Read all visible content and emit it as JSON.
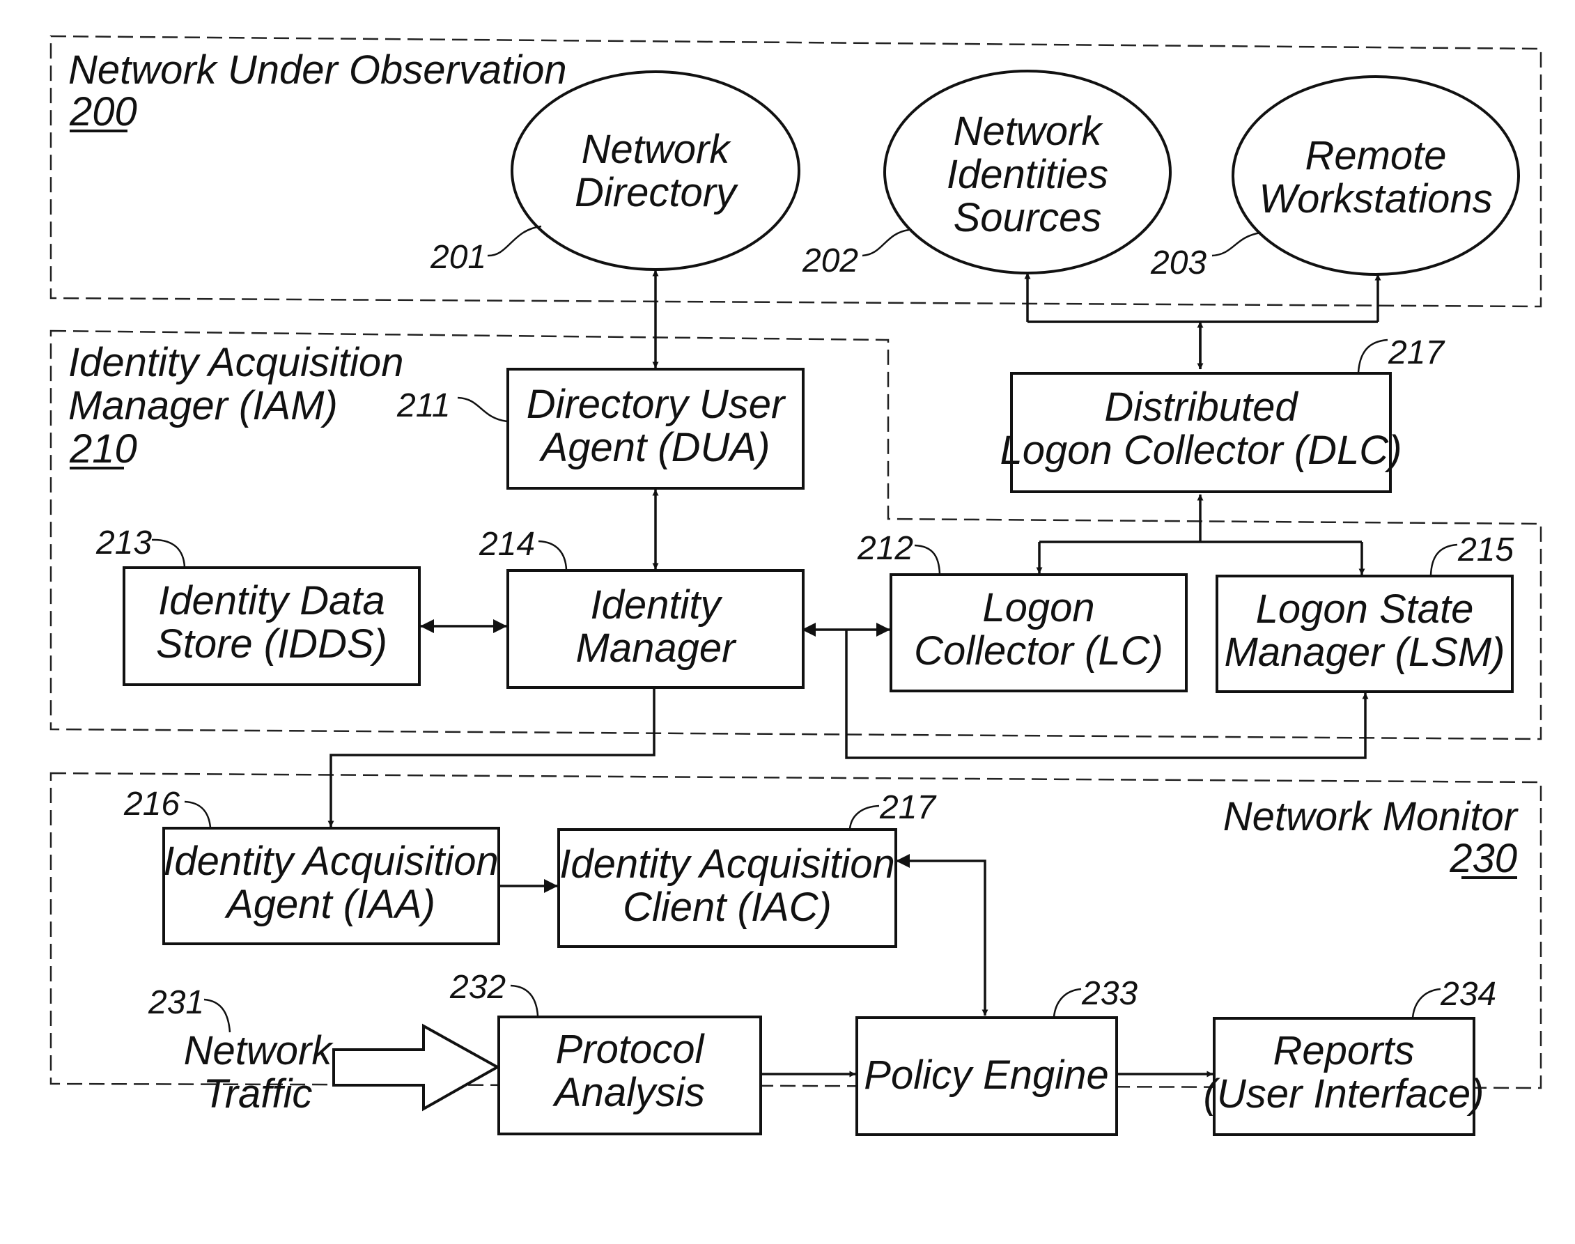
{
  "groups": {
    "network_under_observation": {
      "title": "Network Under Observation",
      "ref": "200"
    },
    "iam": {
      "title_line1": "Identity Acquisition",
      "title_line2": "Manager (IAM)",
      "ref": "210"
    },
    "network_monitor": {
      "title": "Network Monitor",
      "ref": "230"
    }
  },
  "nodes": {
    "network_directory": {
      "lines": [
        "Network",
        "Directory"
      ],
      "ref": "201",
      "shape": "ellipse"
    },
    "network_identities_sources": {
      "lines": [
        "Network",
        "Identities",
        "Sources"
      ],
      "ref": "202",
      "shape": "ellipse"
    },
    "remote_workstations": {
      "lines": [
        "Remote",
        "Workstations"
      ],
      "ref": "203",
      "shape": "ellipse"
    },
    "dua": {
      "lines": [
        "Directory User",
        "Agent (DUA)"
      ],
      "ref": "211",
      "shape": "box"
    },
    "dlc": {
      "lines": [
        "Distributed",
        "Logon Collector (DLC)"
      ],
      "ref": "217",
      "shape": "box"
    },
    "idds": {
      "lines": [
        "Identity Data",
        "Store (IDDS)"
      ],
      "ref": "213",
      "shape": "box"
    },
    "identity_manager": {
      "lines": [
        "Identity",
        "Manager"
      ],
      "ref": "214",
      "shape": "box"
    },
    "logon_collector": {
      "lines": [
        "Logon",
        "Collector (LC)"
      ],
      "ref": "212",
      "shape": "box"
    },
    "lsm": {
      "lines": [
        "Logon State",
        "Manager (LSM)"
      ],
      "ref": "215",
      "shape": "box"
    },
    "iaa": {
      "lines": [
        "Identity Acquisition",
        "Agent (IAA)"
      ],
      "ref": "216",
      "shape": "box"
    },
    "iac": {
      "lines": [
        "Identity Acquisition",
        "Client (IAC)"
      ],
      "ref": "217",
      "shape": "box"
    },
    "network_traffic": {
      "lines": [
        "Network",
        "Traffic"
      ],
      "ref": "231",
      "shape": "block-arrow"
    },
    "protocol_analysis": {
      "lines": [
        "Protocol",
        "Analysis"
      ],
      "ref": "232",
      "shape": "box"
    },
    "policy_engine": {
      "lines": [
        "Policy Engine"
      ],
      "ref": "233",
      "shape": "box"
    },
    "reports": {
      "lines": [
        "Reports",
        "(User Interface)"
      ],
      "ref": "234",
      "shape": "box"
    }
  },
  "edges": [
    {
      "from": "dua",
      "to": "network_directory",
      "direction": "both"
    },
    {
      "from": "dlc",
      "to": "network_identities_sources",
      "direction": "forward"
    },
    {
      "from": "dlc",
      "to": "remote_workstations",
      "direction": "forward"
    },
    {
      "from": "dua",
      "to": "identity_manager",
      "direction": "both"
    },
    {
      "from": "idds",
      "to": "identity_manager",
      "direction": "both"
    },
    {
      "from": "identity_manager",
      "to": "logon_collector",
      "direction": "both"
    },
    {
      "from": "identity_manager",
      "to": "lsm",
      "direction": "forward"
    },
    {
      "from": "logon_collector",
      "to": "dlc",
      "direction": "forward"
    },
    {
      "from": "dlc",
      "to": "logon_collector",
      "direction": "forward"
    },
    {
      "from": "dlc",
      "to": "lsm",
      "direction": "forward"
    },
    {
      "from": "identity_manager",
      "to": "iaa",
      "direction": "forward"
    },
    {
      "from": "iaa",
      "to": "iac",
      "direction": "forward"
    },
    {
      "from": "iac",
      "to": "policy_engine",
      "direction": "both"
    },
    {
      "from": "network_traffic",
      "to": "protocol_analysis",
      "direction": "forward"
    },
    {
      "from": "protocol_analysis",
      "to": "policy_engine",
      "direction": "forward"
    },
    {
      "from": "policy_engine",
      "to": "reports",
      "direction": "forward"
    }
  ]
}
